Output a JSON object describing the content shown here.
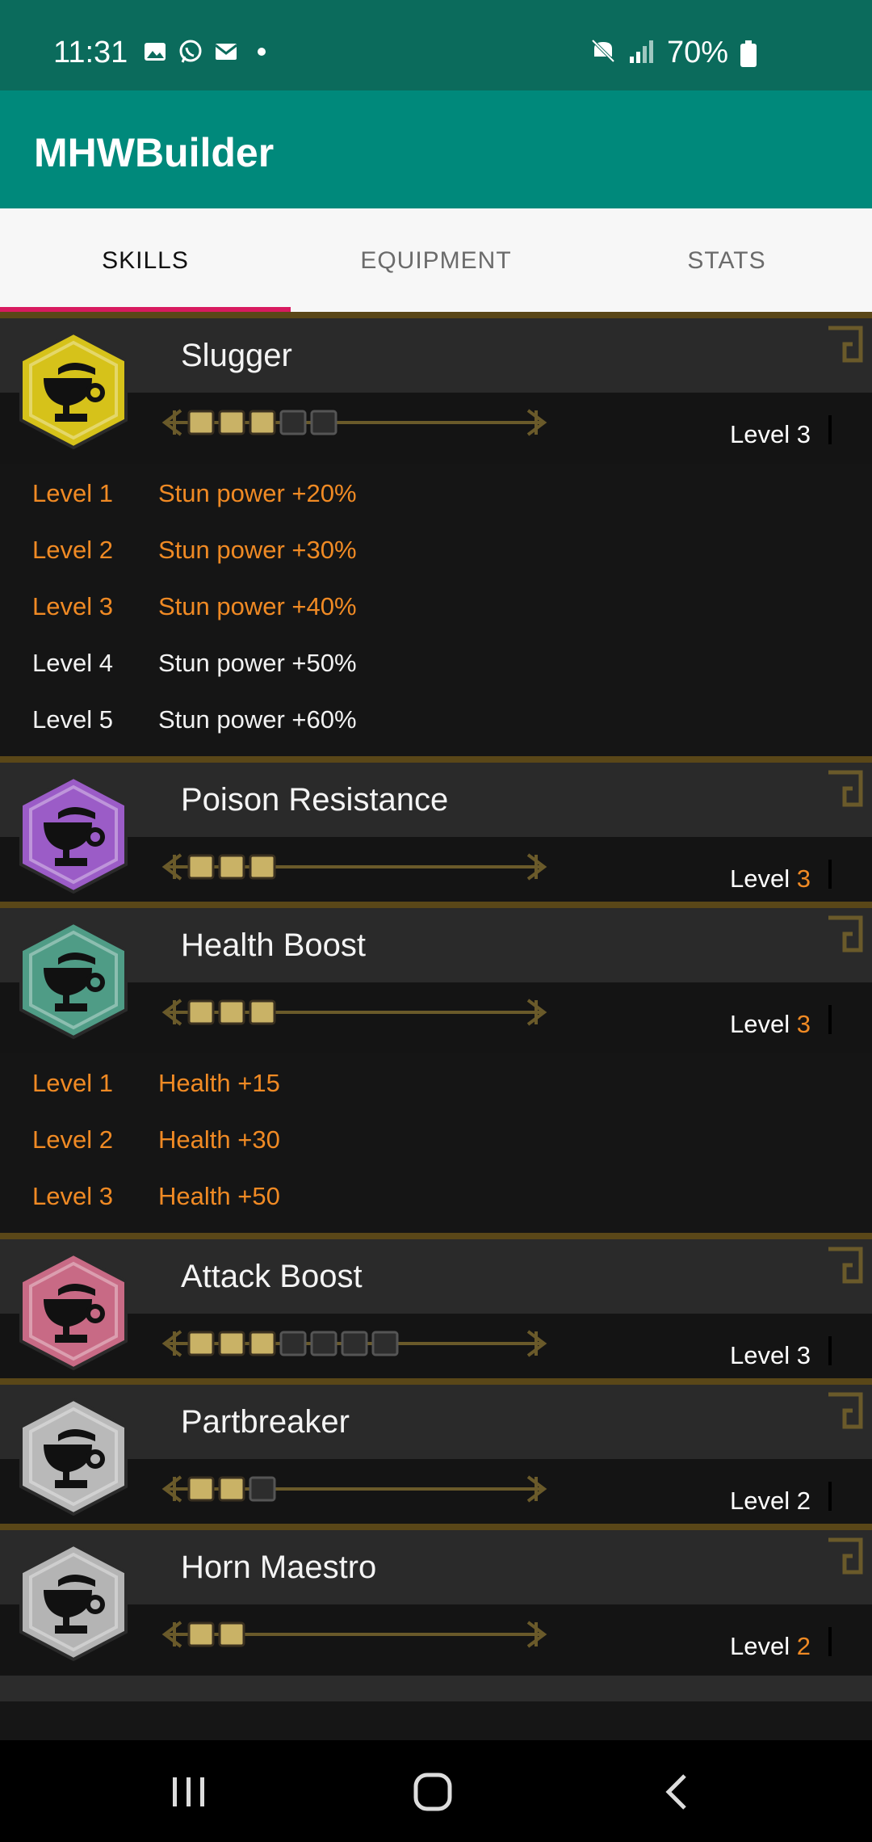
{
  "status_bar": {
    "time": "11:31",
    "battery": "70%",
    "left_icons": [
      "image-icon",
      "whatsapp-icon",
      "gmail-icon",
      "dot-icon"
    ],
    "right_icons": [
      "mute-icon",
      "signal-icon",
      "battery-icon"
    ]
  },
  "app": {
    "title": "MHWBuilder"
  },
  "tabs": [
    {
      "label": "SKILLS",
      "active": true
    },
    {
      "label": "EQUIPMENT",
      "active": false
    },
    {
      "label": "STATS",
      "active": false
    }
  ],
  "skills": [
    {
      "name": "Slugger",
      "color": "#d6c21a",
      "level_label": "Level",
      "level": "3",
      "level_highlight": false,
      "filled": 3,
      "empty": 2,
      "expanded": true,
      "details": [
        {
          "level": "Level 1",
          "text": "Stun power +20%",
          "active": true
        },
        {
          "level": "Level 2",
          "text": "Stun power +30%",
          "active": true
        },
        {
          "level": "Level 3",
          "text": "Stun power +40%",
          "active": true
        },
        {
          "level": "Level 4",
          "text": "Stun power +50%",
          "active": false
        },
        {
          "level": "Level 5",
          "text": "Stun power +60%",
          "active": false
        }
      ]
    },
    {
      "name": "Poison Resistance",
      "color": "#9b5cc7",
      "level_label": "Level",
      "level": "3",
      "level_highlight": true,
      "filled": 3,
      "empty": 0,
      "expanded": false,
      "details": []
    },
    {
      "name": "Health Boost",
      "color": "#4f9c86",
      "level_label": "Level",
      "level": "3",
      "level_highlight": true,
      "filled": 3,
      "empty": 0,
      "expanded": true,
      "details": [
        {
          "level": "Level 1",
          "text": "Health +15",
          "active": true
        },
        {
          "level": "Level 2",
          "text": "Health +30",
          "active": true
        },
        {
          "level": "Level 3",
          "text": "Health +50",
          "active": true
        }
      ]
    },
    {
      "name": "Attack Boost",
      "color": "#c86a85",
      "level_label": "Level",
      "level": "3",
      "level_highlight": false,
      "filled": 3,
      "empty": 4,
      "expanded": false,
      "details": []
    },
    {
      "name": "Partbreaker",
      "color": "#b9b9b9",
      "level_label": "Level",
      "level": "2",
      "level_highlight": false,
      "filled": 2,
      "empty": 1,
      "expanded": false,
      "details": []
    },
    {
      "name": "Horn Maestro",
      "color": "#b4b4b4",
      "level_label": "Level",
      "level": "2",
      "level_highlight": true,
      "filled": 2,
      "empty": 0,
      "expanded": false,
      "details": []
    }
  ],
  "nav": {
    "icons": [
      "recents-icon",
      "home-icon",
      "back-icon"
    ]
  }
}
